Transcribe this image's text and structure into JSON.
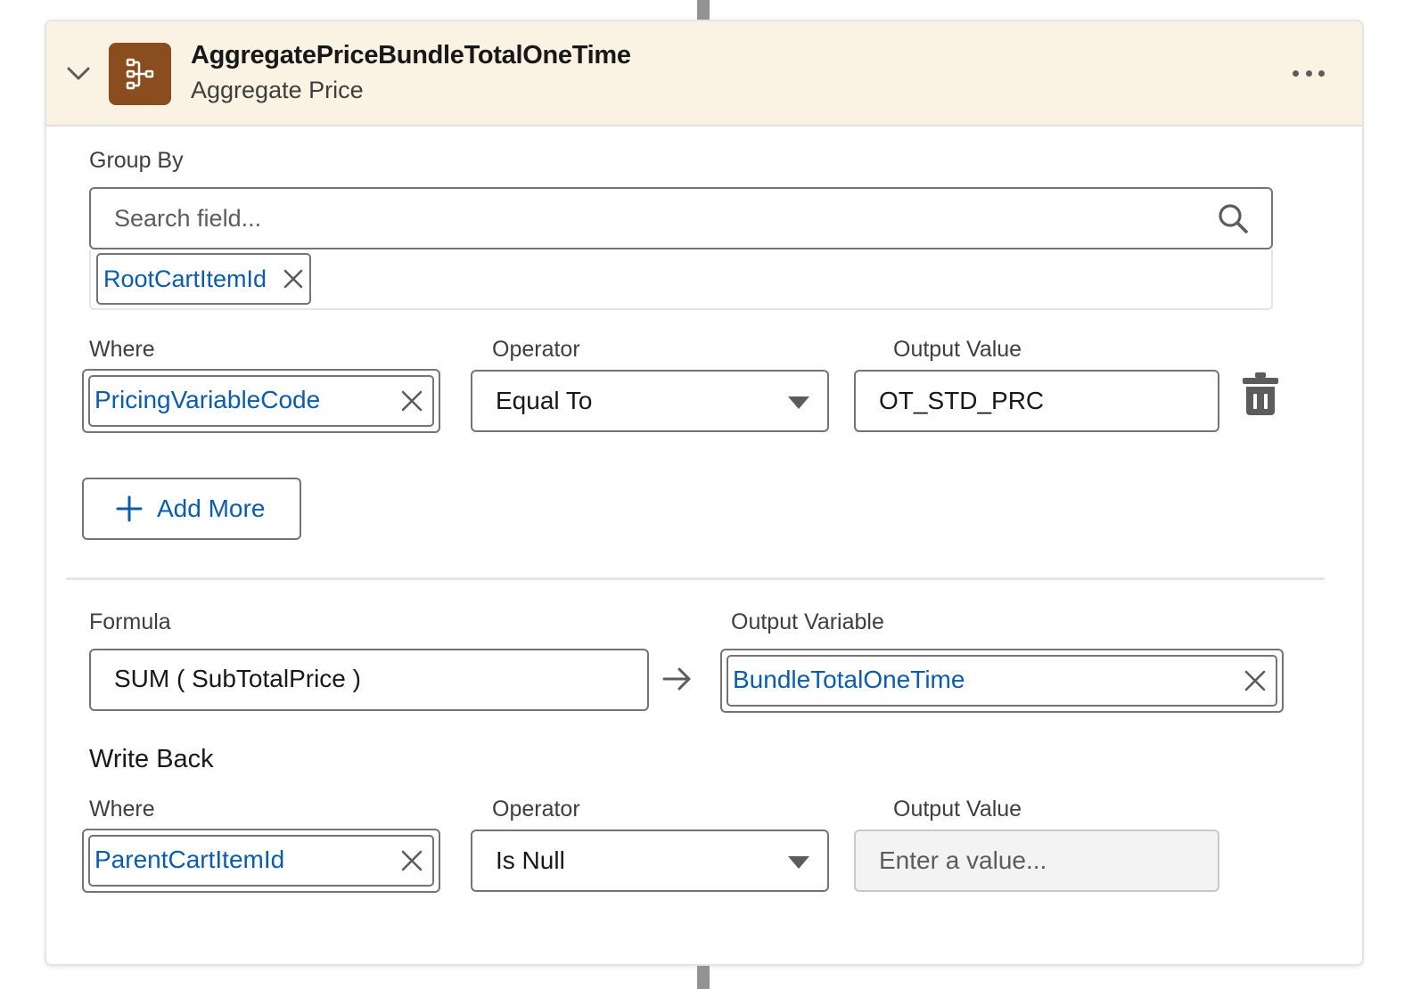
{
  "header": {
    "title": "AggregatePriceBundleTotalOneTime",
    "subtitle": "Aggregate Price",
    "icon": "aggregate-price-icon",
    "icon_color": "#8a4d1d",
    "background": "#faf2e2"
  },
  "group_by": {
    "label": "Group By",
    "search_placeholder": "Search field...",
    "search_value": "",
    "selected": [
      {
        "label": "RootCartItemId"
      }
    ]
  },
  "conditions": {
    "where_label": "Where",
    "operator_label": "Operator",
    "output_value_label": "Output Value",
    "rows": [
      {
        "field": "PricingVariableCode",
        "operator": "Equal To",
        "value": "OT_STD_PRC"
      }
    ]
  },
  "add_more_label": "Add More",
  "formula": {
    "label": "Formula",
    "value": "SUM ( SubTotalPrice )",
    "output_variable_label": "Output Variable",
    "output_variable": "BundleTotalOneTime"
  },
  "write_back": {
    "title": "Write Back",
    "where_label": "Where",
    "operator_label": "Operator",
    "output_value_label": "Output Value",
    "field": "ParentCartItemId",
    "operator": "Is Null",
    "value_placeholder": "Enter a value..."
  },
  "colors": {
    "link": "#0b5cab",
    "border": "#747474",
    "connector": "#939393"
  }
}
